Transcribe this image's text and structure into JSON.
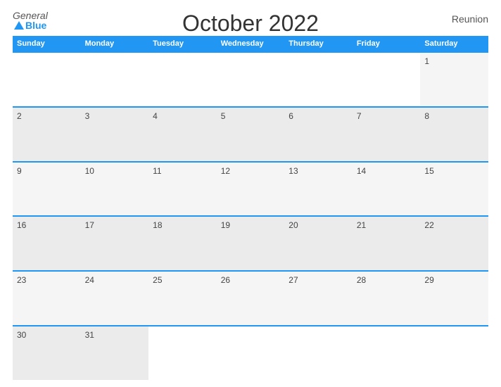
{
  "header": {
    "logo_general": "General",
    "logo_blue": "Blue",
    "title": "October 2022",
    "region": "Reunion"
  },
  "calendar": {
    "days": [
      "Sunday",
      "Monday",
      "Tuesday",
      "Wednesday",
      "Thursday",
      "Friday",
      "Saturday"
    ],
    "rows": [
      [
        "",
        "",
        "",
        "",
        "",
        "",
        "1"
      ],
      [
        "2",
        "3",
        "4",
        "5",
        "6",
        "7",
        "8"
      ],
      [
        "9",
        "10",
        "11",
        "12",
        "13",
        "14",
        "15"
      ],
      [
        "16",
        "17",
        "18",
        "19",
        "20",
        "21",
        "22"
      ],
      [
        "23",
        "24",
        "25",
        "26",
        "27",
        "28",
        "29"
      ],
      [
        "30",
        "31",
        "",
        "",
        "",
        "",
        ""
      ]
    ]
  }
}
